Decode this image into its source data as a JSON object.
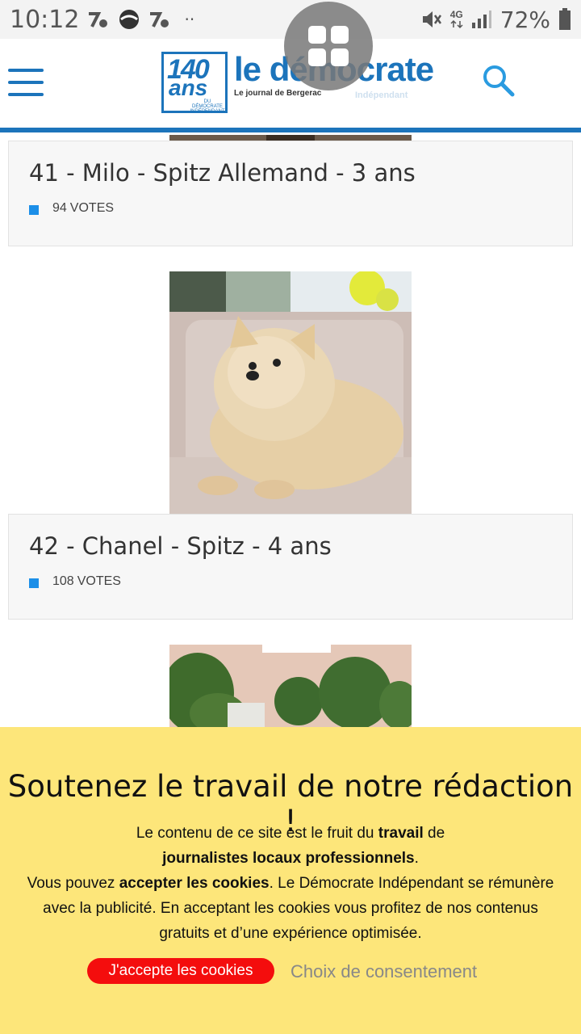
{
  "status_bar": {
    "time": "10:12",
    "dots": "··",
    "network": "4G",
    "battery": "72%"
  },
  "header": {
    "logo_number": "140",
    "logo_ans": "ans",
    "logo_small": "DU DÉMOCRATE INDÉPENDANT",
    "logo_title": "le démocrate",
    "logo_subtitle": "Le journal de Bergerac",
    "logo_independant": "Indépendant"
  },
  "entries": [
    {
      "title": "41 - Milo - Spitz Allemand - 3 ans",
      "votes": "94",
      "votes_label": "VOTES"
    },
    {
      "title": "42 - Chanel - Spitz - 4 ans",
      "votes": "108",
      "votes_label": "VOTES"
    }
  ],
  "cookie": {
    "title": "Soutenez le travail de notre rédaction !",
    "line1_a": "Le contenu de ce site est le fruit du ",
    "line1_b": "travail",
    "line1_c": " de",
    "line2_a": "journalistes locaux professionnels",
    "line2_b": ".",
    "line3_a": "Vous pouvez ",
    "line3_b": "accepter les cookies",
    "line3_c": ". Le Démocrate Indépendant se rémunère avec la publicité. En acceptant les cookies vous profitez de nos contenus gratuits et d’une expérience optimisée.",
    "accept_label": "J'accepte les cookies",
    "consent_label": "Choix de consentement"
  },
  "colors": {
    "brand_blue": "#1c74bb",
    "banner_yellow": "#fde67a",
    "accept_red": "#f40d0d",
    "vote_dot": "#1c8fe8"
  }
}
